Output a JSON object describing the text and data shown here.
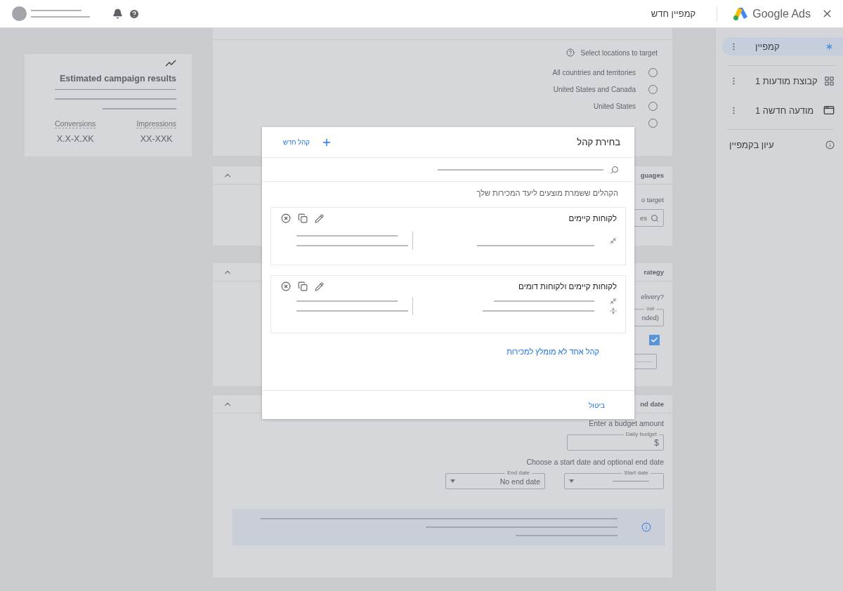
{
  "top_bar": {
    "page_title": "קמפיין חדש",
    "product": "Google Ads"
  },
  "sidebar": {
    "items": [
      {
        "label": "קמפיין",
        "kind": "campaign",
        "selected": true
      },
      {
        "label": "קבוצת מודעות 1",
        "kind": "ad_group",
        "selected": false
      },
      {
        "label": "מודעה חדשה 1",
        "kind": "ad",
        "selected": false
      }
    ],
    "review": {
      "label": "עיון בקמפיין"
    }
  },
  "estimate_card": {
    "title": "Estimated campaign results",
    "metrics": [
      {
        "label": "Impressions",
        "value": "XX-XXK"
      },
      {
        "label": "Conversions",
        "value": "X.X-X.XK"
      }
    ]
  },
  "location_section": {
    "prompt": "Select locations to target",
    "options": [
      {
        "label": "All countries and territories",
        "selected": false
      },
      {
        "label": "United States and Canada",
        "selected": false
      },
      {
        "label": "United States",
        "selected": false
      },
      {
        "selected": false
      }
    ]
  },
  "languages_section": {
    "title": "guages",
    "prompt": "o target",
    "search_value": "es"
  },
  "bidding_section": {
    "title": "rategy",
    "question": "elivery?",
    "field_label": "oal",
    "field_value": "nded)",
    "checked": true
  },
  "budget_section": {
    "title": "nd date",
    "budget_prompt": "Enter a budget amount",
    "budget_field": {
      "label": "Daily budget",
      "currency": "$"
    },
    "dates_prompt": "Choose a start date and optional end date",
    "date_fields": [
      {
        "label": "Start date"
      },
      {
        "label": "End date",
        "value": "No end date"
      }
    ]
  },
  "dialog": {
    "title": "בחירת קהל",
    "new_button": "קהל חדש",
    "description": "הקהלים ששמרת מוצעים ליעד המכירות שלך",
    "audiences": [
      {
        "name": "לקוחות קיימים",
        "kind": "single"
      },
      {
        "name": "לקוחות קיימים ולקוחות דומים",
        "kind": "combined"
      }
    ],
    "link": "קהל אחד לא מומלץ למכירות",
    "cancel": "ביטול"
  }
}
